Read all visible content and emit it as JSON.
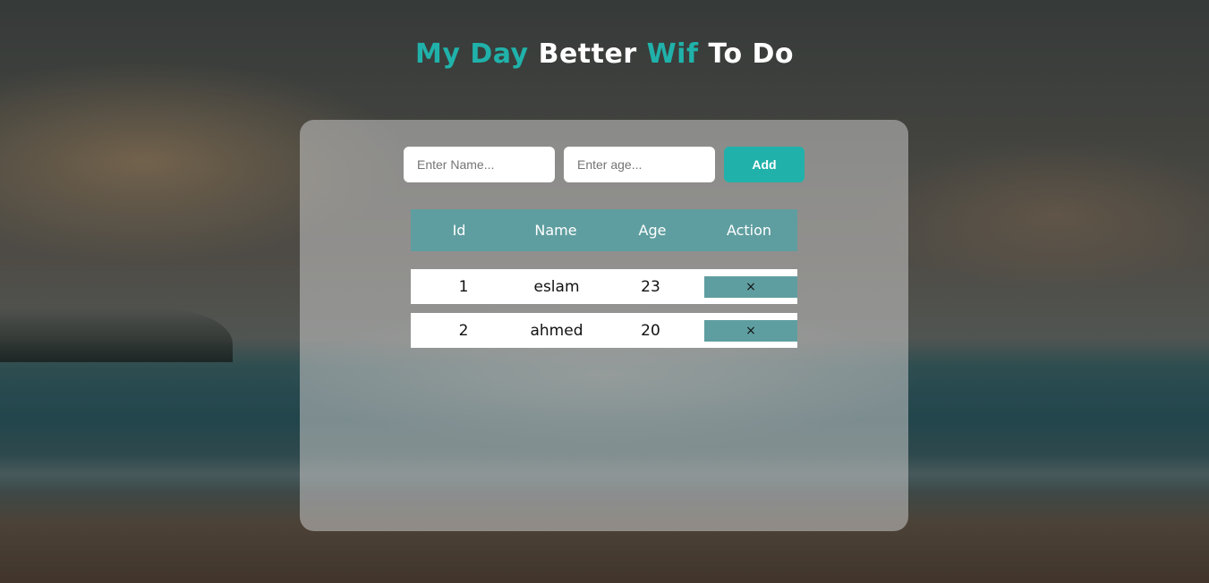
{
  "title": {
    "part1": "My Day",
    "part2": "Better",
    "part3": "Wif",
    "part4": "To Do"
  },
  "form": {
    "name_placeholder": "Enter Name...",
    "age_placeholder": "Enter age...",
    "add_label": "Add"
  },
  "table": {
    "headers": {
      "id": "Id",
      "name": "Name",
      "age": "Age",
      "action": "Action"
    },
    "rows": [
      {
        "id": "1",
        "name": "eslam",
        "age": "23",
        "action": "×"
      },
      {
        "id": "2",
        "name": "ahmed",
        "age": "20",
        "action": "×"
      }
    ]
  },
  "colors": {
    "accent": "#20b2aa",
    "table_header": "#5f9ea0"
  }
}
